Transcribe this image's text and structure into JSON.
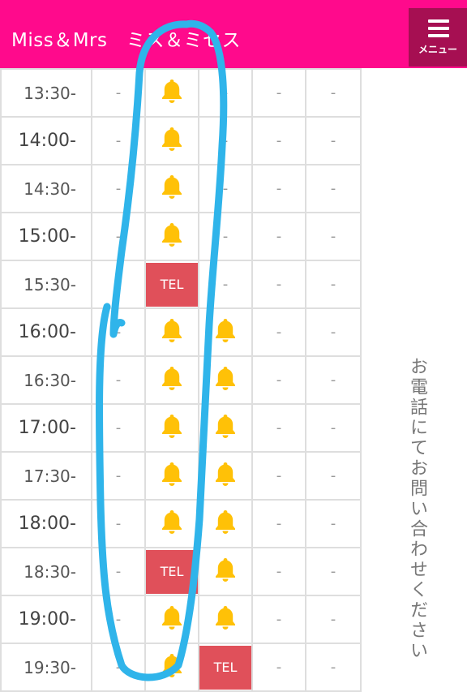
{
  "header": {
    "title": "Miss＆Mrs　ミス＆ミセス",
    "menu_label": "メニュー",
    "background": "#ff0a8c",
    "menu_background": "#a60f52"
  },
  "schedule": {
    "rows": [
      {
        "time": "13:30-",
        "cells": [
          "-",
          "bell",
          "-",
          "-",
          "-"
        ]
      },
      {
        "time": "14:00-",
        "cells": [
          "-",
          "bell",
          "-",
          "-",
          "-"
        ]
      },
      {
        "time": "14:30-",
        "cells": [
          "-",
          "bell",
          "-",
          "-",
          "-"
        ]
      },
      {
        "time": "15:00-",
        "cells": [
          "-",
          "bell",
          "-",
          "-",
          "-"
        ]
      },
      {
        "time": "15:30-",
        "cells": [
          "-",
          "TEL",
          "-",
          "-",
          "-"
        ]
      },
      {
        "time": "16:00-",
        "cells": [
          "-",
          "bell",
          "bell",
          "-",
          "-"
        ]
      },
      {
        "time": "16:30-",
        "cells": [
          "-",
          "bell",
          "bell",
          "-",
          "-"
        ]
      },
      {
        "time": "17:00-",
        "cells": [
          "-",
          "bell",
          "bell",
          "-",
          "-"
        ]
      },
      {
        "time": "17:30-",
        "cells": [
          "-",
          "bell",
          "bell",
          "-",
          "-"
        ]
      },
      {
        "time": "18:00-",
        "cells": [
          "-",
          "bell",
          "bell",
          "-",
          "-"
        ]
      },
      {
        "time": "18:30-",
        "cells": [
          "-",
          "TEL",
          "bell",
          "-",
          "-"
        ]
      },
      {
        "time": "19:00-",
        "cells": [
          "-",
          "bell",
          "bell",
          "-",
          "-"
        ]
      },
      {
        "time": "19:30-",
        "cells": [
          "-",
          "bell",
          "TEL",
          "-",
          "-"
        ]
      }
    ],
    "bell_color": "#ffc107",
    "tel_color": "#e0505a"
  },
  "sidebar": {
    "contact_note": "お電話にてお問い合わせください"
  },
  "annotation": {
    "color": "#2fb4ea"
  }
}
